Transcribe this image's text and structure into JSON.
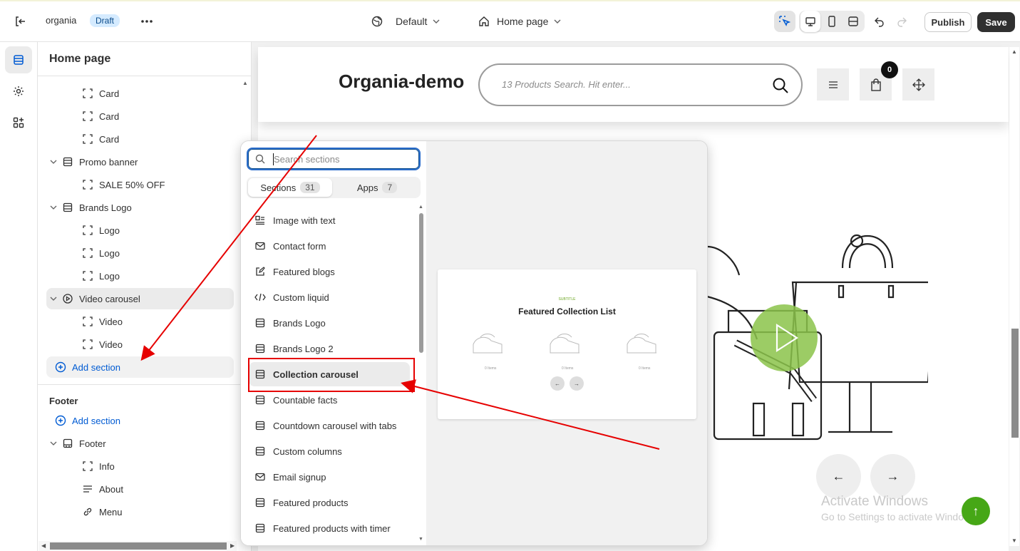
{
  "topbar": {
    "store_name": "organia",
    "status_badge": "Draft",
    "theme": "Default",
    "page": "Home page",
    "publish_label": "Publish",
    "save_label": "Save"
  },
  "sidebar": {
    "title": "Home page",
    "rows": [
      {
        "label": "Card",
        "icon": "block-icon"
      },
      {
        "label": "Card",
        "icon": "block-icon"
      },
      {
        "label": "Card",
        "icon": "block-icon"
      },
      {
        "label": "Promo banner",
        "icon": "section-icon"
      },
      {
        "label": "SALE 50% OFF",
        "icon": "block-icon"
      },
      {
        "label": "Brands Logo",
        "icon": "section-icon"
      },
      {
        "label": "Logo",
        "icon": "block-icon"
      },
      {
        "label": "Logo",
        "icon": "block-icon"
      },
      {
        "label": "Logo",
        "icon": "block-icon"
      },
      {
        "label": "Video carousel",
        "icon": "play-icon"
      },
      {
        "label": "Video",
        "icon": "block-icon"
      },
      {
        "label": "Video",
        "icon": "block-icon"
      },
      {
        "label": "Add section",
        "icon": "plus-circle-icon"
      }
    ],
    "footer_group": {
      "heading": "Footer",
      "add_label": "Add section",
      "rows": [
        {
          "label": "Footer",
          "icon": "footer-icon"
        },
        {
          "label": "Info",
          "icon": "block-icon"
        },
        {
          "label": "About",
          "icon": "text-lines-icon"
        },
        {
          "label": "Menu",
          "icon": "link-icon"
        }
      ]
    }
  },
  "picker": {
    "search_placeholder": "Search sections",
    "tabs": [
      {
        "label": "Sections",
        "count": "31"
      },
      {
        "label": "Apps",
        "count": "7"
      }
    ],
    "items": [
      {
        "label": "Image with text",
        "icon": "image-text-icon"
      },
      {
        "label": "Contact form",
        "icon": "envelope-icon"
      },
      {
        "label": "Featured blogs",
        "icon": "edit-icon"
      },
      {
        "label": "Custom liquid",
        "icon": "code-icon"
      },
      {
        "label": "Brands Logo",
        "icon": "section-icon"
      },
      {
        "label": "Brands Logo 2",
        "icon": "section-icon"
      },
      {
        "label": "Collection carousel",
        "icon": "section-icon"
      },
      {
        "label": "Countable facts",
        "icon": "section-icon"
      },
      {
        "label": "Countdown carousel with tabs",
        "icon": "section-icon"
      },
      {
        "label": "Custom columns",
        "icon": "section-icon"
      },
      {
        "label": "Email signup",
        "icon": "envelope-icon"
      },
      {
        "label": "Featured products",
        "icon": "section-icon"
      },
      {
        "label": "Featured products with timer",
        "icon": "section-icon"
      }
    ],
    "preview": {
      "subtitle": "SUBTITLE",
      "title": "Featured Collection List",
      "items_label": "0 Items",
      "prev": "←",
      "next": "→"
    }
  },
  "storefront": {
    "logo": "Organia-demo",
    "search_placeholder": "13 Products Search. Hit enter...",
    "cart_count": "0",
    "prev_arrow": "←",
    "next_arrow": "→",
    "activate_title": "Activate Windows",
    "activate_sub": "Go to Settings to activate Windows.",
    "go_top": "↑"
  },
  "colors": {
    "accent_blue": "#005bd3",
    "annotation_red": "#e60000",
    "play_green": "#8bc34a",
    "go_top_green": "#46a716"
  }
}
